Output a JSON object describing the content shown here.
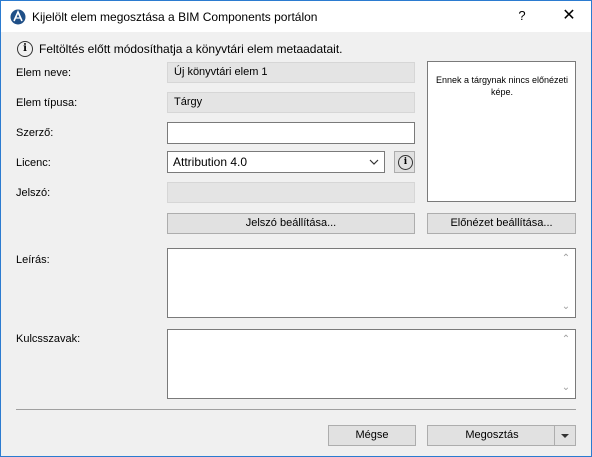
{
  "window": {
    "title": "Kijelölt elem megosztása a BIM Components portálon",
    "help": "?",
    "close": "✕"
  },
  "info": {
    "text": "Feltöltés előtt módosíthatja a könyvtári elem metaadatait."
  },
  "fields": {
    "name_label": "Elem neve:",
    "name_value": "Új könyvtári elem 1",
    "type_label": "Elem típusa:",
    "type_value": "Tárgy",
    "author_label": "Szerző:",
    "author_value": "",
    "license_label": "Licenc:",
    "license_value": "Attribution 4.0",
    "password_label": "Jelszó:",
    "password_value": ""
  },
  "preview": {
    "text": "Ennek a tárgynak nincs előnézeti képe."
  },
  "buttons": {
    "set_password": "Jelszó beállítása...",
    "set_preview": "Előnézet beállítása...",
    "cancel": "Mégse",
    "share": "Megosztás"
  },
  "description": {
    "label": "Leírás:",
    "value": ""
  },
  "keywords": {
    "label": "Kulcsszavak:",
    "value": ""
  }
}
